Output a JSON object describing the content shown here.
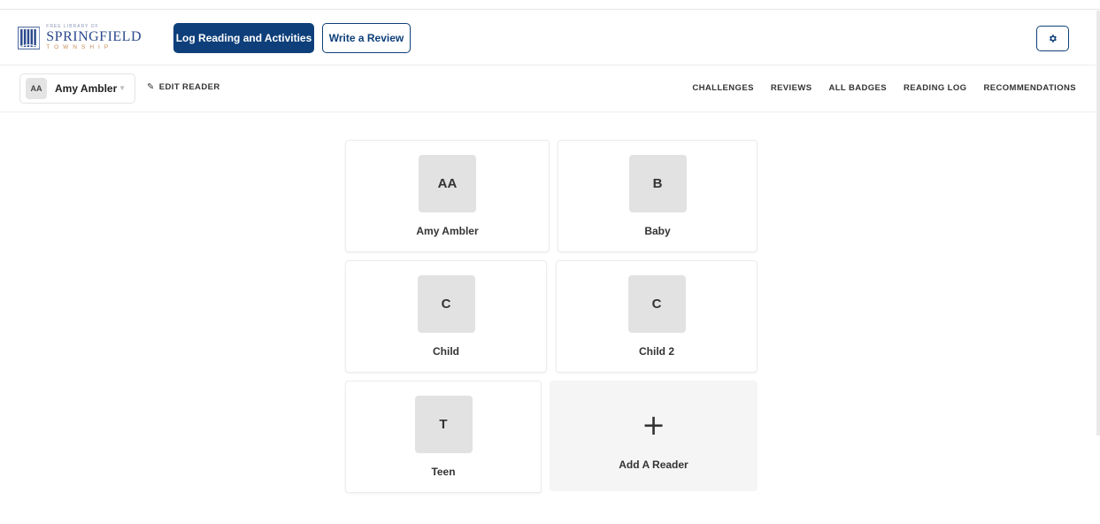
{
  "header": {
    "logo": {
      "small": "FREE LIBRARY OF",
      "main": "SPRINGFIELD",
      "sub": "TOWNSHIP"
    },
    "log_button": "Log Reading and Activities",
    "review_button": "Write a Review",
    "settings_icon": "gear-icon"
  },
  "subnav": {
    "reader": {
      "initials": "AA",
      "name": "Amy Ambler"
    },
    "edit_reader": "EDIT READER",
    "links": [
      "CHALLENGES",
      "REVIEWS",
      "ALL BADGES",
      "READING LOG",
      "RECOMMENDATIONS"
    ]
  },
  "readers": [
    {
      "initials": "AA",
      "name": "Amy Ambler"
    },
    {
      "initials": "B",
      "name": "Baby"
    },
    {
      "initials": "C",
      "name": "Child"
    },
    {
      "initials": "C",
      "name": "Child 2"
    },
    {
      "initials": "T",
      "name": "Teen"
    }
  ],
  "add_reader": {
    "symbol": "+",
    "label": "Add A Reader"
  },
  "colors": {
    "brand": "#0e3f7a",
    "logo_blue": "#2b4a8c",
    "logo_accent": "#c38a57"
  }
}
